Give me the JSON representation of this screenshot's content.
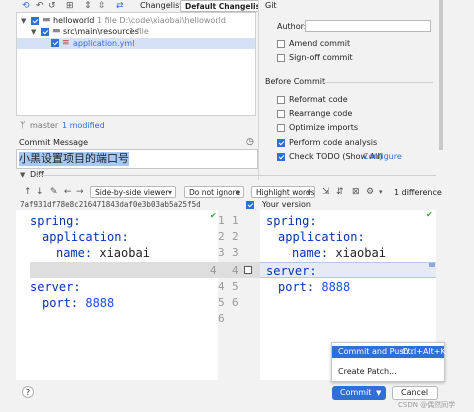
{
  "toolbar": {
    "changelist_label": "Changelist:",
    "changelist_value": "Default Changelist"
  },
  "tree": {
    "root": {
      "name": "helloworld",
      "meta": "1 file D:\\code\\xiaobai\\helloworld"
    },
    "folder": {
      "name": "src\\main\\resources",
      "meta": "1 file"
    },
    "file": {
      "name": "application.yml"
    }
  },
  "branch": {
    "name": "master",
    "modified": "1 modified"
  },
  "commit_message": {
    "label": "Commit Message",
    "text": "小黑设置项目的端口号"
  },
  "git": {
    "section": "Git",
    "author_label": "Author:",
    "author_value": "",
    "amend": "Amend commit",
    "signoff": "Sign-off commit"
  },
  "before_commit": {
    "section": "Before Commit",
    "items": [
      {
        "label": "Reformat code",
        "checked": false
      },
      {
        "label": "Rearrange code",
        "checked": false
      },
      {
        "label": "Optimize imports",
        "checked": false
      },
      {
        "label": "Perform code analysis",
        "checked": true
      },
      {
        "label": "Check TODO (Show All)",
        "checked": true,
        "link": "Configure"
      }
    ]
  },
  "diff": {
    "label": "Diff",
    "viewer": "Side-by-side viewer",
    "ignore": "Do not ignore",
    "highlight": "Highlight words",
    "count": "1 difference",
    "left_title": "7af931df78e8c216471843daf0e3b03ab5a25f5d",
    "right_title": "Your version",
    "left_lines": [
      "1",
      "2",
      "3",
      "",
      "4",
      "5",
      "6"
    ],
    "right_lines": [
      "1",
      "2",
      "3",
      "4",
      "5",
      "6"
    ],
    "code": {
      "spring": "spring:",
      "application": "application:",
      "name_key": "name:",
      "name_val": "xiaobai",
      "server": "server:",
      "port_key": "port:",
      "port_val": "8888"
    }
  },
  "popup": {
    "commit_push": "Commit and Push...",
    "shortcut": "Ctrl+Alt+K",
    "create_patch": "Create Patch..."
  },
  "footer": {
    "help": "?",
    "commit": "Commit",
    "cancel": "Cancel",
    "watermark": "CSDN @偶然同学"
  }
}
